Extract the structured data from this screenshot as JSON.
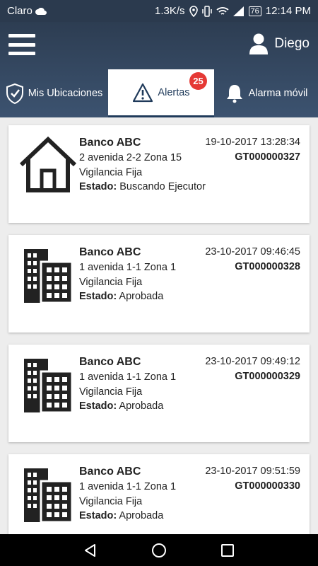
{
  "status_bar": {
    "carrier": "Claro",
    "speed": "1.3K/s",
    "battery": "76",
    "time": "12:14 PM"
  },
  "header": {
    "user_name": "Diego"
  },
  "tabs": [
    {
      "label": "Mis Ubicaciones",
      "icon": "shield-check-icon",
      "selected": false
    },
    {
      "label": "Alertas",
      "icon": "warning-icon",
      "selected": true,
      "badge": "25"
    },
    {
      "label": "Alarma móvil",
      "icon": "bell-icon",
      "selected": false
    }
  ],
  "labels": {
    "status": "Estado:"
  },
  "alerts": [
    {
      "icon": "house-icon",
      "name": "Banco ABC",
      "address": "2 avenida 2-2 Zona 15",
      "service": "Vigilancia Fija",
      "status": "Buscando Ejecutor",
      "datetime": "19-10-2017 13:28:34",
      "code": "GT000000327"
    },
    {
      "icon": "building-icon",
      "name": "Banco ABC",
      "address": "1 avenida 1-1 Zona 1",
      "service": "Vigilancia Fija",
      "status": "Aprobada",
      "datetime": "23-10-2017 09:46:45",
      "code": "GT000000328"
    },
    {
      "icon": "building-icon",
      "name": "Banco ABC",
      "address": "1 avenida 1-1 Zona 1",
      "service": "Vigilancia Fija",
      "status": "Aprobada",
      "datetime": "23-10-2017 09:49:12",
      "code": "GT000000329"
    },
    {
      "icon": "building-icon",
      "name": "Banco ABC",
      "address": "1 avenida 1-1 Zona 1",
      "service": "Vigilancia Fija",
      "status": "Aprobada",
      "datetime": "23-10-2017 09:51:59",
      "code": "GT000000330"
    }
  ],
  "colors": {
    "header": "#2d3d52",
    "badge": "#e53935",
    "selected_tab_text": "#1f3a5a"
  }
}
